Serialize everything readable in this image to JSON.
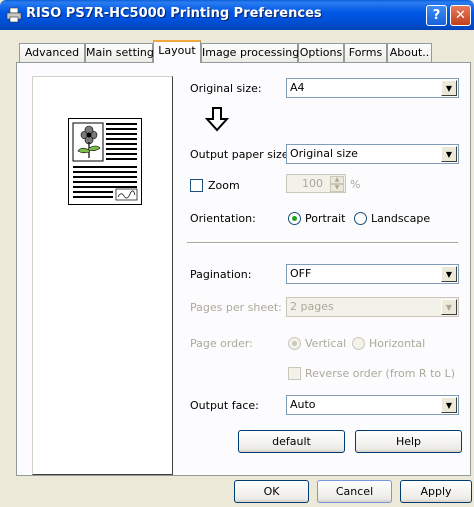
{
  "window": {
    "title": "RISO PS7R-HC5000 Printing Preferences",
    "help_label": "?",
    "close_label": "✕"
  },
  "tabs": [
    {
      "label": "Advanced"
    },
    {
      "label": "Main setting"
    },
    {
      "label": "Layout",
      "active": true
    },
    {
      "label": "Image processing"
    },
    {
      "label": "Options"
    },
    {
      "label": "Forms"
    },
    {
      "label": "About.."
    }
  ],
  "layout": {
    "original_size": {
      "label": "Original size:",
      "value": "A4"
    },
    "output_paper_size": {
      "label": "Output paper size:",
      "value": "Original size"
    },
    "zoom": {
      "label": "Zoom",
      "value": "100",
      "unit": "%",
      "checked": false,
      "enabled": false
    },
    "orientation": {
      "label": "Orientation:",
      "options": [
        "Portrait",
        "Landscape"
      ],
      "selected": "Portrait"
    },
    "pagination": {
      "label": "Pagination:",
      "value": "OFF"
    },
    "pages_per_sheet": {
      "label": "Pages per sheet:",
      "value": "2 pages",
      "enabled": false
    },
    "page_order": {
      "label": "Page order:",
      "options": [
        "Vertical",
        "Horizontal"
      ],
      "selected": "Vertical",
      "enabled": false
    },
    "reverse_order": {
      "label": "Reverse order (from R to L)",
      "checked": false,
      "enabled": false
    },
    "output_face": {
      "label": "Output face:",
      "value": "Auto"
    },
    "default_label": "default",
    "help_label": "Help"
  },
  "footer": {
    "ok_label": "OK",
    "cancel_label": "Cancel",
    "apply_label": "Apply"
  },
  "icons": {
    "arrow": "down-arrow-icon",
    "preview": "page-preview-icon",
    "app": "printer-icon"
  },
  "colors": {
    "titlebar": "#0058e6",
    "dialog_bg": "#ece9d8",
    "panel_bg": "#fcfcfe",
    "tab_highlight": "#f1a83c",
    "disabled_text": "#aca899"
  }
}
